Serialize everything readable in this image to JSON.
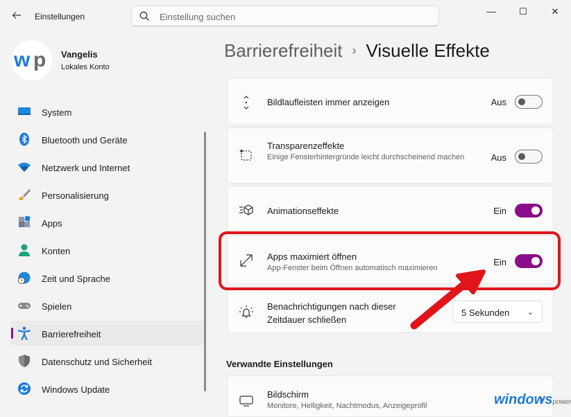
{
  "window": {
    "title": "Einstellungen",
    "back_icon": "arrow-left-icon"
  },
  "search": {
    "placeholder": "Einstellung suchen"
  },
  "window_controls": {
    "minimize": "—",
    "maximize": "☐",
    "close": "✕"
  },
  "profile": {
    "name": "Vangelis",
    "account": "Lokales Konto",
    "avatar_text": "wp"
  },
  "sidebar": {
    "items": [
      {
        "label": "System",
        "icon": "monitor-icon",
        "active": false
      },
      {
        "label": "Bluetooth und Geräte",
        "icon": "bluetooth-icon",
        "active": false
      },
      {
        "label": "Netzwerk und Internet",
        "icon": "wifi-icon",
        "active": false
      },
      {
        "label": "Personalisierung",
        "icon": "brush-icon",
        "active": false
      },
      {
        "label": "Apps",
        "icon": "apps-icon",
        "active": false
      },
      {
        "label": "Konten",
        "icon": "person-icon",
        "active": false
      },
      {
        "label": "Zeit und Sprache",
        "icon": "globe-clock-icon",
        "active": false
      },
      {
        "label": "Spielen",
        "icon": "gamepad-icon",
        "active": false
      },
      {
        "label": "Barrierefreiheit",
        "icon": "accessibility-icon",
        "active": true
      },
      {
        "label": "Datenschutz und Sicherheit",
        "icon": "shield-icon",
        "active": false
      },
      {
        "label": "Windows Update",
        "icon": "update-icon",
        "active": false
      }
    ]
  },
  "breadcrumb": {
    "parent": "Barrierefreiheit",
    "separator": "›",
    "current": "Visuelle Effekte"
  },
  "settings": {
    "scrollbars": {
      "title": "Bildlaufleisten immer anzeigen",
      "state": "Aus",
      "on": false
    },
    "transparency": {
      "title": "Transparenzeffekte",
      "desc": "Einige Fensterhintergründe leicht durchscheinend machen",
      "state": "Aus",
      "on": false
    },
    "animation": {
      "title": "Animationseffekte",
      "state": "Ein",
      "on": true
    },
    "maximize": {
      "title": "Apps maximiert öffnen",
      "desc": "App-Fenster beim Öffnen automatisch maximieren",
      "state": "Ein",
      "on": true
    },
    "notifications": {
      "title": "Benachrichtigungen nach dieser Zeitdauer schließen",
      "value": "5 Sekunden"
    }
  },
  "related": {
    "heading": "Verwandte Einstellungen",
    "display": {
      "title": "Bildschirm",
      "desc": "Monitore, Helligkeit, Nachtmodus, Anzeigeprofil"
    }
  },
  "watermark": {
    "main": "windows",
    "suffix": "power"
  },
  "colors": {
    "accent": "#8a0e8a",
    "highlight": "#e0151a"
  }
}
